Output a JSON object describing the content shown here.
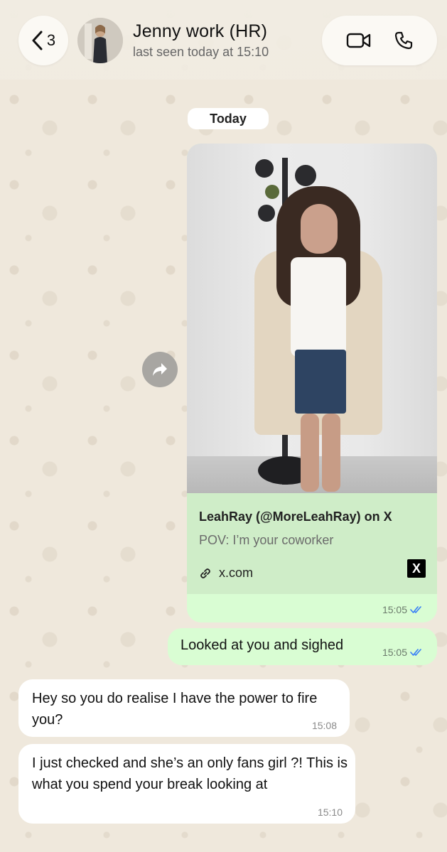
{
  "header": {
    "back_count": "3",
    "contact_name": "Jenny work (HR)",
    "last_seen": "last seen today at 15:10"
  },
  "date_separator": "Today",
  "messages": [
    {
      "type": "link",
      "direction": "outgoing",
      "preview_title": "LeahRay (@MoreLeahRay) on X",
      "preview_description": "POV: I’m your coworker",
      "preview_domain": "x.com",
      "site_icon": "X",
      "time": "15:05",
      "read": true
    },
    {
      "type": "text",
      "direction": "outgoing",
      "text": "Looked at you and sighed",
      "time": "15:05",
      "read": true
    },
    {
      "type": "text",
      "direction": "incoming",
      "text": "Hey so you do realise I have the power to fire you?",
      "time": "15:08"
    },
    {
      "type": "text",
      "direction": "incoming",
      "text": "I just checked and she’s an only fans girl ?! This is what you spend your break looking at",
      "time": "15:10"
    }
  ],
  "colors": {
    "outgoing_bubble": "#d9fdd3",
    "incoming_bubble": "#ffffff",
    "read_ticks": "#3b82f6",
    "background": "#efe8dc"
  }
}
